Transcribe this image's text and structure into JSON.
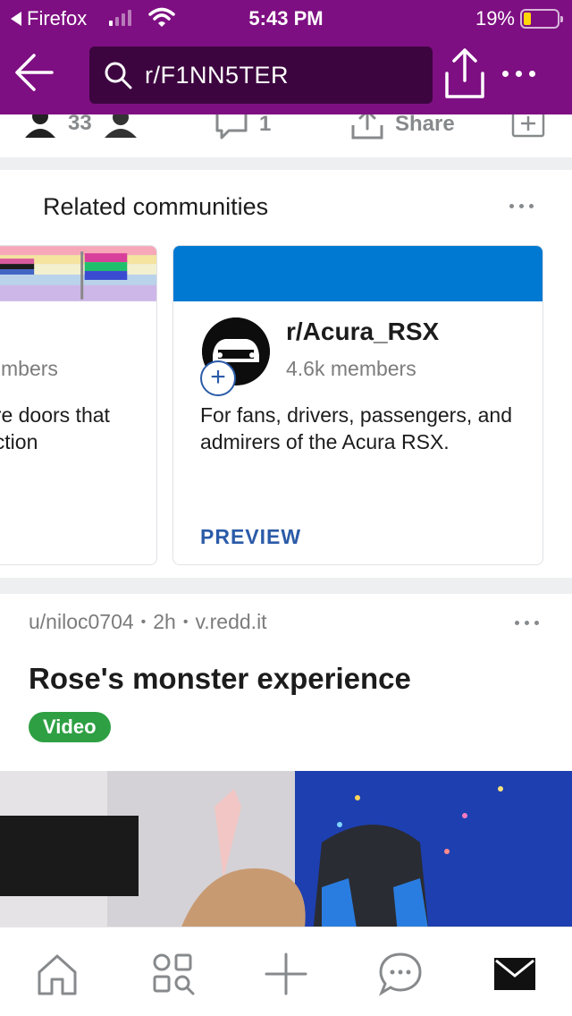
{
  "status_bar": {
    "back_app_label": "Firefox",
    "time": "5:43 PM",
    "battery_percent": "19%",
    "battery_level": 0.19,
    "signal_bars_active": 1
  },
  "nav": {
    "search_text": "r/F1NN5TER",
    "icons": [
      "back-arrow-icon",
      "search-icon",
      "share-icon",
      "more-icon"
    ]
  },
  "prev_post_actions": {
    "vote_count": "33",
    "comment_count": "1",
    "share_label": "Share"
  },
  "related": {
    "title": "Related communities",
    "cards": [
      {
        "members": "mbers",
        "desc_line1": "are doors that",
        "desc_line2": "ection"
      },
      {
        "name": "r/Acura_RSX",
        "members": "4.6k members",
        "desc": "For fans, drivers, passengers, and admirers of the Acura RSX.",
        "preview_label": "PREVIEW"
      }
    ]
  },
  "post": {
    "author": "u/niloc0704",
    "age": "2h",
    "domain": "v.redd.it",
    "title": "Rose's monster experience",
    "flair": "Video"
  },
  "tabbar": {
    "tabs": [
      "home-icon",
      "discover-icon",
      "create-icon",
      "chat-icon",
      "inbox-icon"
    ]
  },
  "colors": {
    "header_bg": "#7e0f82",
    "search_bg": "#3d0540",
    "community_banner": "#0079d3",
    "preview_text": "#2b5ba8",
    "flair_bg": "#2ea043"
  }
}
